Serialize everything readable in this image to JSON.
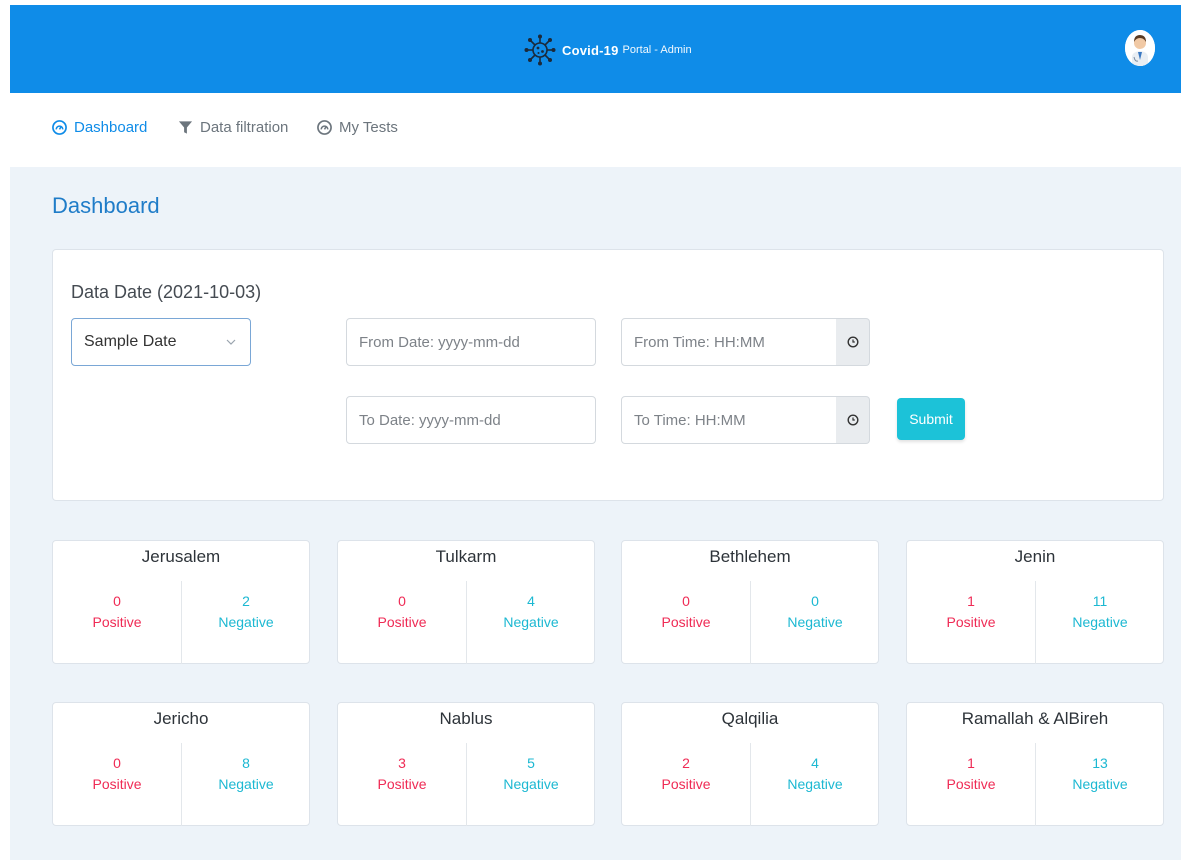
{
  "header": {
    "brand_bold": "Covid-19",
    "brand_rest": "Portal - Admin"
  },
  "nav": {
    "items": [
      {
        "label": "Dashboard",
        "icon": "dashboard-icon"
      },
      {
        "label": "Data filtration",
        "icon": "filter-icon"
      },
      {
        "label": "My Tests",
        "icon": "dashboard-icon"
      }
    ]
  },
  "page": {
    "title": "Dashboard"
  },
  "filter": {
    "title": "Data Date (2021-10-03)",
    "select_value": "Sample Date",
    "from_date_placeholder": "From Date: yyyy-mm-dd",
    "from_time_placeholder": "From Time: HH:MM",
    "to_date_placeholder": "To Date: yyyy-mm-dd",
    "to_time_placeholder": "To Time: HH:MM",
    "submit_label": "Submit"
  },
  "labels": {
    "positive": "Positive",
    "negative": "Negative"
  },
  "colors": {
    "accent": "#0f8ce8",
    "positive": "#ef2b55",
    "negative": "#1cb8d2",
    "submit": "#1cc2d8"
  },
  "cities": [
    {
      "name": "Jerusalem",
      "positive": "0",
      "negative": "2"
    },
    {
      "name": "Tulkarm",
      "positive": "0",
      "negative": "4"
    },
    {
      "name": "Bethlehem",
      "positive": "0",
      "negative": "0"
    },
    {
      "name": "Jenin",
      "positive": "1",
      "negative": "11"
    },
    {
      "name": "Jericho",
      "positive": "0",
      "negative": "8"
    },
    {
      "name": "Nablus",
      "positive": "3",
      "negative": "5"
    },
    {
      "name": "Qalqilia",
      "positive": "2",
      "negative": "4"
    },
    {
      "name": "Ramallah & AlBireh",
      "positive": "1",
      "negative": "13"
    }
  ]
}
